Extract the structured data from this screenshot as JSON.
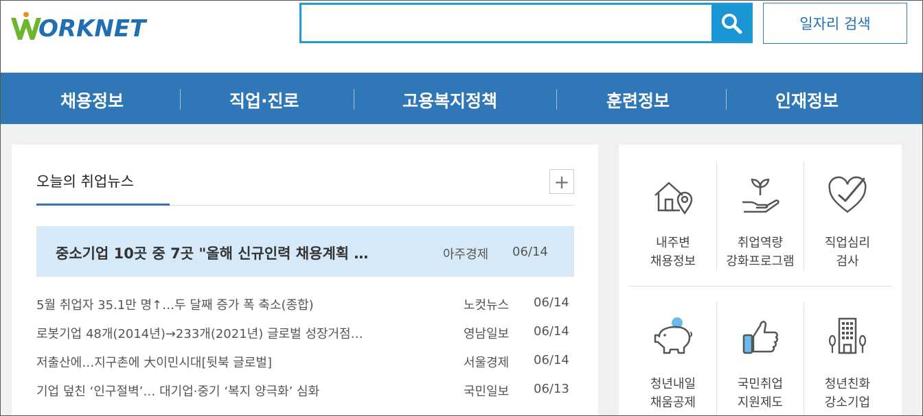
{
  "header": {
    "logo_text": "ORKNET",
    "search": {
      "value": "",
      "placeholder": ""
    },
    "job_search_label": "일자리 검색",
    "brand_color": "#2f77b7",
    "search_color": "#1a96d4"
  },
  "nav": {
    "items": [
      {
        "label": "채용정보"
      },
      {
        "label": "직업·진로"
      },
      {
        "label": "고용복지정책"
      },
      {
        "label": "훈련정보"
      },
      {
        "label": "인재정보"
      }
    ]
  },
  "news": {
    "tab_label": "오늘의 취업뉴스",
    "more_label": "+",
    "headline": {
      "title": "중소기업 10곳 중 7곳 \"올해 신규인력 채용계획 …",
      "source": "아주경제",
      "date": "06/14"
    },
    "items": [
      {
        "title": "5월 취업자 35.1만 명↑…두 달째 증가 폭 축소(종합)",
        "source": "노컷뉴스",
        "date": "06/14"
      },
      {
        "title": "로봇기업 48개(2014년)→233개(2021년) 글로벌 성장거점…",
        "source": "영남일보",
        "date": "06/14"
      },
      {
        "title": "저출산에…지구촌에 大이민시대[뒷북 글로벌]",
        "source": "서울경제",
        "date": "06/14"
      },
      {
        "title": "기업 덮친 ‘인구절벽’… 대기업·중기 ‘복지 양극화’ 심화",
        "source": "국민일보",
        "date": "06/13"
      }
    ]
  },
  "services": {
    "items": [
      {
        "label": "내주변\n채용정보",
        "icon": "house-location-icon"
      },
      {
        "label": "취업역량\n강화프로그램",
        "icon": "hand-sprout-icon"
      },
      {
        "label": "직업심리\n검사",
        "icon": "heart-check-icon"
      },
      {
        "label": "청년내일\n채움공제",
        "icon": "piggy-bank-icon"
      },
      {
        "label": "국민취업\n지원제도",
        "icon": "thumbs-up-icon"
      },
      {
        "label": "청년친화\n강소기업",
        "icon": "building-icon"
      }
    ]
  }
}
